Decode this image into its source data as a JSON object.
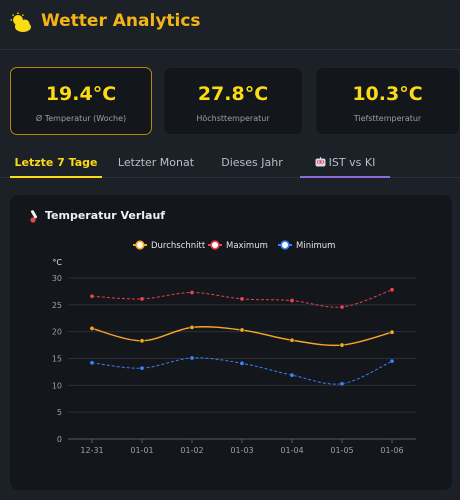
{
  "app": {
    "title": "Wetter Analytics",
    "logo_icon": "sun-cloud-icon"
  },
  "stats": [
    {
      "value": "19.4°C",
      "label": "Ø Temperatur (Woche)",
      "active": true
    },
    {
      "value": "27.8°C",
      "label": "Höchsttemperatur",
      "active": false
    },
    {
      "value": "10.3°C",
      "label": "Tiefsttemperatur",
      "active": false
    }
  ],
  "tabs": [
    {
      "label": "Letzte 7 Tage",
      "active": true
    },
    {
      "label": "Letzter Monat",
      "active": false
    },
    {
      "label": "Dieses Jahr",
      "active": false
    },
    {
      "label": "IST vs KI",
      "active": false,
      "icon": "robot-icon"
    }
  ],
  "panel": {
    "title": "Temperatur Verlauf",
    "icon": "thermometer-icon"
  },
  "colors": {
    "accent": "#fadb14",
    "brand": "#f5b416",
    "tab_highlight": "#8e6bd8"
  },
  "chart_data": {
    "type": "line",
    "ylabel": "°C",
    "xlabel": "",
    "ylim": [
      0,
      30
    ],
    "yticks": [
      0,
      5,
      10,
      15,
      20,
      25,
      30
    ],
    "grid": true,
    "legend": "top-center",
    "categories": [
      "12-31",
      "01-01",
      "01-02",
      "01-03",
      "01-04",
      "01-05",
      "01-06"
    ],
    "series": [
      {
        "name": "Durchschnitt",
        "color": "#f5a623",
        "dashed": false,
        "values": [
          20.6,
          18.3,
          20.8,
          20.3,
          18.4,
          17.5,
          19.9
        ]
      },
      {
        "name": "Maximum",
        "color": "#e8434b",
        "dashed": true,
        "values": [
          26.6,
          26.1,
          27.3,
          26.1,
          25.8,
          24.6,
          27.8
        ]
      },
      {
        "name": "Minimum",
        "color": "#3b82f6",
        "dashed": true,
        "values": [
          14.2,
          13.2,
          15.1,
          14.1,
          11.9,
          10.3,
          14.5
        ]
      }
    ]
  }
}
